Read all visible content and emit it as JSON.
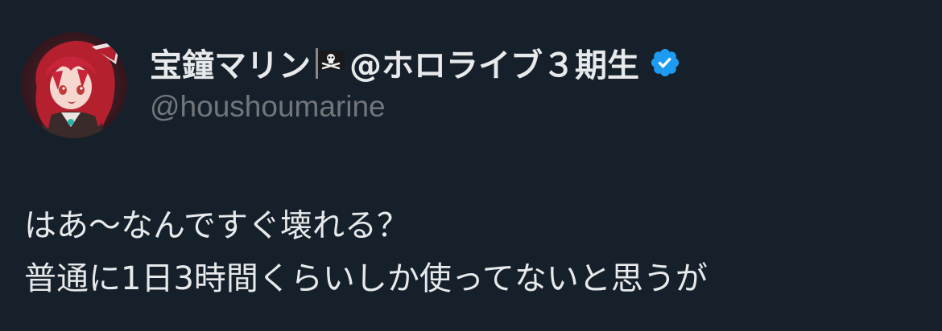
{
  "author": {
    "display_name": "宝鐘マリン",
    "flag_icon": "pirate-flag-icon",
    "name_suffix": "@ホロライブ３期生",
    "verified_icon": "verified-badge-icon",
    "verified_color": "#1d9bf0",
    "handle": "@houshoumarine"
  },
  "tweet": {
    "lines": [
      "はあ〜なんですぐ壊れる？",
      "普通に1日3時間くらいしか使ってないと思うが"
    ]
  },
  "colors": {
    "background": "#16202b",
    "text": "#e7e9ea",
    "muted": "#71767b"
  }
}
